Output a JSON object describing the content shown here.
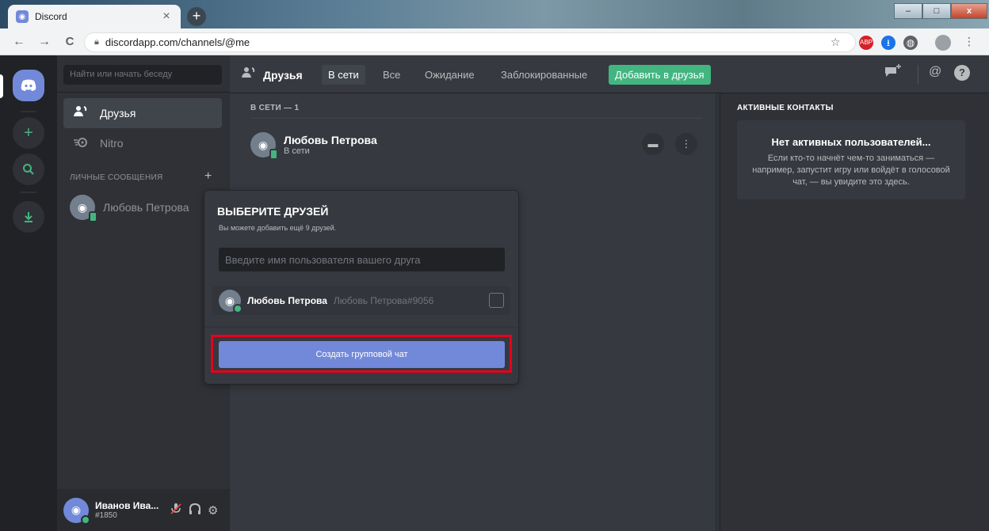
{
  "browser": {
    "tab_title": "Discord",
    "tab_close": "×",
    "new_tab": "+",
    "back": "←",
    "forward": "→",
    "reload": "C",
    "url": "discordapp.com/channels/@me",
    "star": "☆",
    "ext_abp": "ABP",
    "ext_download": "⭳",
    "ext_globe": "◍",
    "kebab": "⋮",
    "win_min": "–",
    "win_max": "□",
    "win_close": "x"
  },
  "sidebar": {
    "search_placeholder": "Найти или начать беседу",
    "friends": "Друзья",
    "nitro": "Nitro",
    "dm_header": "ЛИЧНЫЕ СООБЩЕНИЯ",
    "dm_add": "+",
    "dm_user": "Любовь Петрова"
  },
  "user": {
    "name": "Иванов Ива...",
    "tag": "#1850"
  },
  "header": {
    "title": "Друзья",
    "tabs": {
      "online": "В сети",
      "all": "Все",
      "pending": "Ожидание",
      "blocked": "Заблокированные",
      "add": "Добавить в друзья"
    }
  },
  "friends_list": {
    "online_count": "В СЕТИ — 1",
    "friend_name": "Любовь Петрова",
    "friend_status": "В сети"
  },
  "active_now": {
    "title": "АКТИВНЫЕ КОНТАКТЫ",
    "heading": "Нет активных пользователей...",
    "text": "Если кто-то начнёт чем-то заниматься — например, запустит игру или войдёт в голосовой чат, — вы увидите это здесь."
  },
  "popup": {
    "title": "ВЫБЕРИТЕ ДРУЗЕЙ",
    "subtitle": "Вы можете добавить ещё 9 друзей.",
    "input_placeholder": "Введите имя пользователя вашего друга",
    "friend_name": "Любовь Петрова",
    "friend_tag": "Любовь Петрова#9056",
    "create_button": "Создать групповой чат"
  },
  "colors": {
    "blurple": "#7289da",
    "green": "#43b581",
    "highlight": "#e8001c"
  }
}
